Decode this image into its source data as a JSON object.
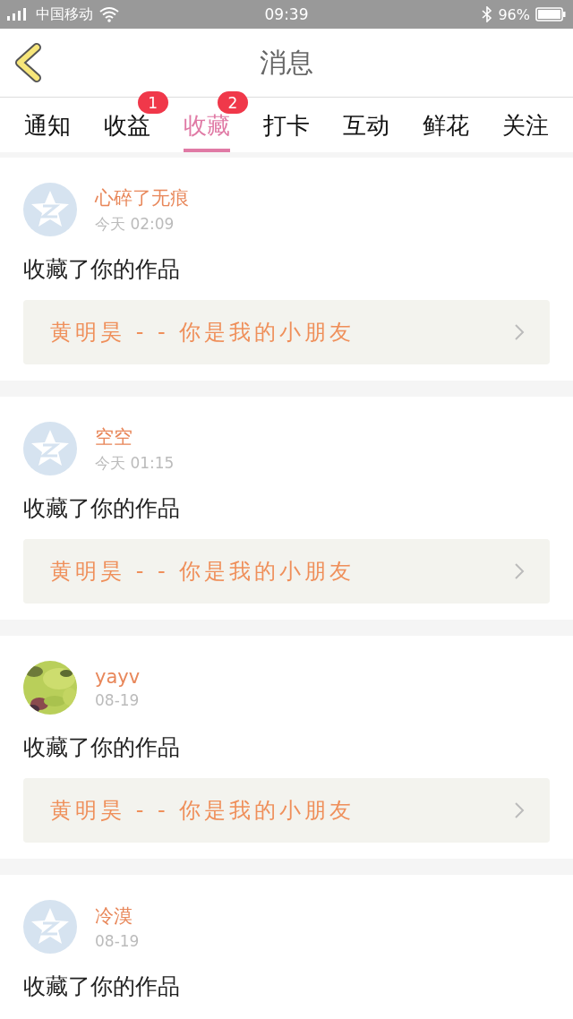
{
  "status_bar": {
    "carrier": "中国移动",
    "time": "09:39",
    "battery": "96%"
  },
  "header": {
    "title": "消息"
  },
  "tabs": [
    {
      "label": "通知",
      "selected": false
    },
    {
      "label": "收益",
      "selected": false,
      "badge": "1"
    },
    {
      "label": "收藏",
      "selected": true,
      "badge": "2"
    },
    {
      "label": "打卡",
      "selected": false
    },
    {
      "label": "互动",
      "selected": false
    },
    {
      "label": "鲜花",
      "selected": false
    },
    {
      "label": "关注",
      "selected": false
    }
  ],
  "messages": [
    {
      "avatar": {
        "kind": "default"
      },
      "name": "心碎了无痕",
      "time": "今天 02:09",
      "text": "收藏了你的作品",
      "work": "黄明昊 - - 你是我的小朋友"
    },
    {
      "avatar": {
        "kind": "default"
      },
      "name": "空空",
      "time": "今天 01:15",
      "text": "收藏了你的作品",
      "work": "黄明昊 - - 你是我的小朋友"
    },
    {
      "name": "yayv",
      "time": "08-19",
      "text": "收藏了你的作品",
      "work": "黄明昊 - - 你是我的小朋友"
    },
    {
      "avatar": {
        "kind": "default"
      },
      "name": "冷漠",
      "time": "08-19",
      "text": "收藏了你的作品"
    }
  ]
}
